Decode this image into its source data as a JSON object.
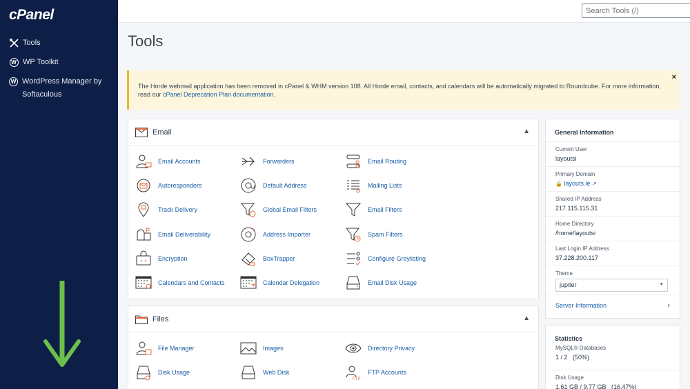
{
  "sidebar": {
    "logo": "cPanel",
    "items": [
      {
        "label": "Tools"
      },
      {
        "label": "WP Toolkit"
      },
      {
        "label": "WordPress Manager by Softaculous"
      }
    ]
  },
  "search": {
    "placeholder": "Search Tools (/)"
  },
  "page": {
    "title": "Tools"
  },
  "notice": {
    "text": "The Horde webmail application has been removed in cPanel & WHM version 108. All Horde email, contacts, and calendars will be automatically migrated to Roundcube. For more information, read our ",
    "link": "cPanel Deprecation Plan documentation",
    "suffix": ".",
    "close": "×"
  },
  "email": {
    "title": "Email",
    "tools": [
      {
        "label": "Email Accounts",
        "icon": "user-mail-icon"
      },
      {
        "label": "Forwarders",
        "icon": "forward-arrow-icon"
      },
      {
        "label": "Email Routing",
        "icon": "routing-icon"
      },
      {
        "label": "Autoresponders",
        "icon": "autoresponder-icon"
      },
      {
        "label": "Default Address",
        "icon": "at-icon"
      },
      {
        "label": "Mailing Lists",
        "icon": "list-icon"
      },
      {
        "label": "Track Delivery",
        "icon": "location-pin-icon"
      },
      {
        "label": "Global Email Filters",
        "icon": "filter-globe-icon"
      },
      {
        "label": "Email Filters",
        "icon": "filter-icon"
      },
      {
        "label": "Email Deliverability",
        "icon": "mailbox-icon"
      },
      {
        "label": "Address Importer",
        "icon": "at-import-icon"
      },
      {
        "label": "Spam Filters",
        "icon": "filter-clock-icon"
      },
      {
        "label": "Encryption",
        "icon": "lock-box-icon"
      },
      {
        "label": "BoxTrapper",
        "icon": "boxtrapper-icon"
      },
      {
        "label": "Configure Greylisting",
        "icon": "greylisting-icon"
      },
      {
        "label": "Calendars and Contacts",
        "icon": "calendar-icon"
      },
      {
        "label": "Calendar Delegation",
        "icon": "calendar-delegation-icon"
      },
      {
        "label": "Email Disk Usage",
        "icon": "disk-icon"
      }
    ]
  },
  "files": {
    "title": "Files",
    "tools": [
      {
        "label": "File Manager",
        "icon": "file-user-icon"
      },
      {
        "label": "Images",
        "icon": "image-icon"
      },
      {
        "label": "Directory Privacy",
        "icon": "eye-icon"
      },
      {
        "label": "Disk Usage",
        "icon": "disk-usage-icon"
      },
      {
        "label": "Web Disk",
        "icon": "web-disk-icon"
      },
      {
        "label": "FTP Accounts",
        "icon": "ftp-user-icon"
      }
    ]
  },
  "general": {
    "title": "General Information",
    "current_user_label": "Current User",
    "current_user": "layoutsi",
    "primary_domain_label": "Primary Domain",
    "primary_domain": "layouts.ie",
    "shared_ip_label": "Shared IP Address",
    "shared_ip": "217.115.115.31",
    "home_dir_label": "Home Directory",
    "home_dir": "/home/layoutsi",
    "last_login_label": "Last Login IP Address",
    "last_login": "37.228.200.117",
    "theme_label": "Theme",
    "theme": "jupiter",
    "server_info": "Server Information"
  },
  "stats": {
    "title": "Statistics",
    "mysql_label": "MySQL® Databases",
    "mysql_value": "1 / 2   (50%)",
    "disk_label": "Disk Usage",
    "disk_value": "1.61 GB / 9.77 GB   (16.47%)"
  },
  "colors": {
    "sidebar": "#0d1f47",
    "link": "#1a5fa8",
    "accent_orange": "#e8683a",
    "arrow_green": "#6cbf4a",
    "notice_bg": "#fdf6dc"
  }
}
